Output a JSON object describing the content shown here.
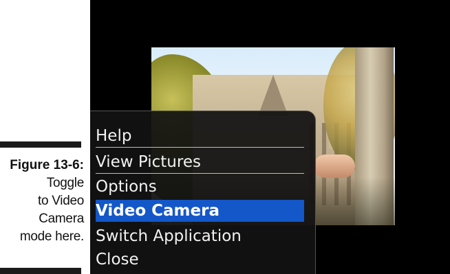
{
  "caption": {
    "figure": "Figure 13-6:",
    "lines": [
      "Toggle",
      "to Video",
      "Camera",
      "mode here."
    ]
  },
  "menu": {
    "items": [
      {
        "label": "Help"
      },
      {
        "label": "View Pictures"
      },
      {
        "label": "Options"
      },
      {
        "label": "Video Camera",
        "selected": true
      },
      {
        "label": "Switch Application"
      },
      {
        "label": "Close"
      }
    ],
    "highlight_color": "#1357c9"
  }
}
